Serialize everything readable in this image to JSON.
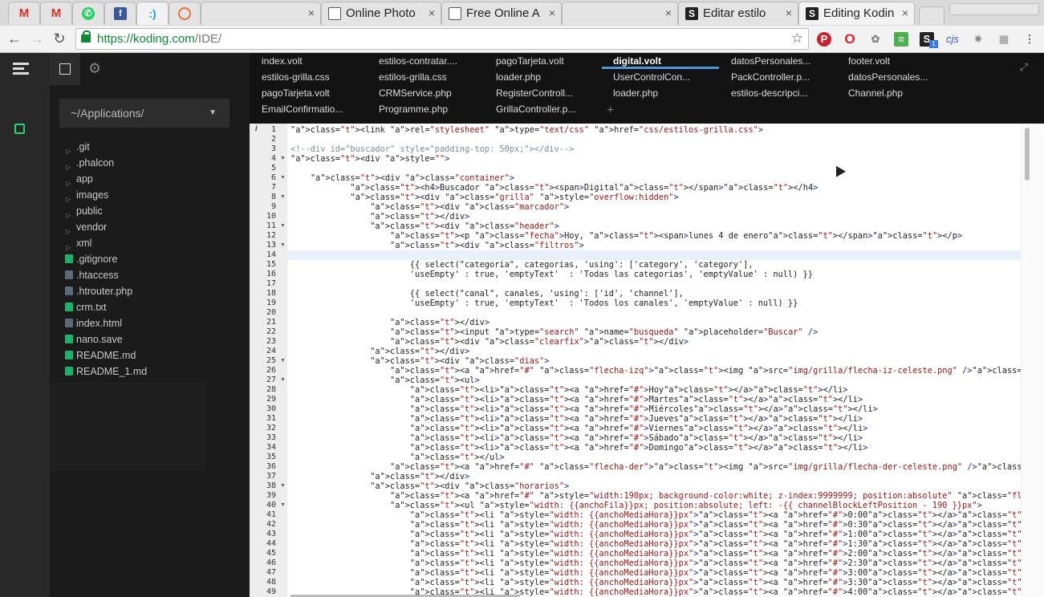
{
  "browser": {
    "tabs": [
      {
        "title": "",
        "icon": "gmail-icon",
        "pinned": true
      },
      {
        "title": "",
        "icon": "gmail-icon",
        "pinned": true
      },
      {
        "title": "",
        "icon": "whatsapp-icon",
        "pinned": true
      },
      {
        "title": "",
        "icon": "facebook-icon",
        "pinned": true
      },
      {
        "title": "",
        "icon": "koding-icon",
        "pinned": true,
        "active": true
      },
      {
        "title": "",
        "icon": "settings-icon",
        "pinned": true
      },
      {
        "title": "",
        "icon": "blank-icon",
        "pinned": false
      },
      {
        "title": "Online Photo",
        "icon": "page-icon"
      },
      {
        "title": "Free Online A",
        "icon": "page-icon"
      },
      {
        "title": "",
        "icon": "blank-icon"
      },
      {
        "title": "Editar estilo",
        "icon": "stylish-icon"
      },
      {
        "title": "Editing Kodin",
        "icon": "stylish-icon"
      }
    ],
    "url": {
      "host": "https://koding.com",
      "path": "/IDE/"
    },
    "extensions": [
      "pinterest-icon",
      "opera-icon",
      "extension-icon",
      "clipboard-icon",
      "stylish-icon",
      "cjs-icon",
      "gear-icon",
      "grid-icon"
    ],
    "ext_cjs_label": "cjs",
    "ext_badge": "1"
  },
  "ide": {
    "folder": "~/Applications/",
    "files": [
      {
        "name": ".git",
        "type": "folder"
      },
      {
        "name": ".phalcon",
        "type": "folder"
      },
      {
        "name": "app",
        "type": "folder"
      },
      {
        "name": "images",
        "type": "folder"
      },
      {
        "name": "public",
        "type": "folder"
      },
      {
        "name": "vendor",
        "type": "folder"
      },
      {
        "name": "xml",
        "type": "folder"
      },
      {
        "name": ".gitignore",
        "type": "file",
        "color": "#19b36b"
      },
      {
        "name": ".htaccess",
        "type": "file",
        "color": "#5a6a7a"
      },
      {
        "name": ".htrouter.php",
        "type": "file",
        "color": "#5a6a7a"
      },
      {
        "name": "crm.txt",
        "type": "file",
        "color": "#19b36b"
      },
      {
        "name": "index.html",
        "type": "file",
        "color": "#5a6a7a"
      },
      {
        "name": "nano.save",
        "type": "file",
        "color": "#19b36b"
      },
      {
        "name": "README.md",
        "type": "file",
        "color": "#19b36b"
      },
      {
        "name": "README_1.md",
        "type": "file",
        "color": "#19b36b"
      }
    ],
    "editor_tabs": [
      [
        "index.volt",
        "estilos-contratar....",
        "pagoTarjeta.volt",
        "digital.volt",
        "datosPersonales...",
        "footer.volt"
      ],
      [
        "estilos-grilla.css",
        "estilos-grilla.css",
        "loader.php",
        "UserControlCon...",
        "PackController.p...",
        "datosPersonales..."
      ],
      [
        "pagoTarjeta.volt",
        "CRMService.php",
        "RegisterControll...",
        "loader.php",
        "estilos-descripci...",
        "Channel.php"
      ],
      [
        "EmailConfirmatio...",
        "Programme.php",
        "GrillaController.p..."
      ]
    ],
    "active_tab": "digital.volt",
    "gutter_info": "i",
    "code_lines": [
      "<link rel=\"stylesheet\" type=\"text/css\" href=\"css/estilos-grilla.css\">",
      "",
      "<!--div id=\"buscador\" style=\"padding-top: 50px;\"></div-->",
      "<div style=\"\">",
      "",
      "    <div class=\"container\">",
      "            <h4>Buscador <span>Digital</span></h4>",
      "            <div class=\"grilla\" style=\"overflow:hidden\">",
      "                <div class=\"marcador\">",
      "                </div>",
      "                <div class=\"header\">",
      "                    <p class=\"fecha\">Hoy, <span>lunes 4 de enero</span></p>",
      "                    <div class=\"filtros\">",
      "",
      "                        {{ select(\"categoria\", categorias, 'using': ['category', 'category'],",
      "                        'useEmpty' : true, 'emptyText'  : 'Todas las categorias', 'emptyValue' : null) }}",
      "",
      "                        {{ select(\"canal\", canales, 'using': ['id', 'channel'],",
      "                        'useEmpty' : true, 'emptyText'  : 'Todos los canales', 'emptyValue' : null) }}",
      "",
      "                    </div>",
      "                    <input type=\"search\" name=\"busqueda\" placeholder=\"Buscar\" />",
      "                    <div class=\"clearfix\"></div>",
      "                </div>",
      "                <div class=\"dias\">",
      "                    <a href=\"#\" class=\"flecha-izq\"><img src=\"img/grilla/flecha-iz-celeste.png\" /></a>",
      "                    <ul>",
      "                        <li><a href=\"#\">Hoy</a></li>",
      "                        <li><a href=\"#\">Martes</a></li>",
      "                        <li><a href=\"#\">Miércoles</a></li>",
      "                        <li><a href=\"#\">Jueves</a></li>",
      "                        <li><a href=\"#\">Viernes</a></li>",
      "                        <li><a href=\"#\">Sábado</a></li>",
      "                        <li><a href=\"#\">Domingo</a></li>",
      "                        </ul>",
      "                    <a href=\"#\" class=\"flecha-der\"><img src=\"img/grilla/flecha-der-celeste.png\" /></a>",
      "                </div>",
      "                <div class=\"horarios\">",
      "                    <a href=\"#\" style=\"width:190px; background-color:white; z-index:9999999; position:absolute\" class=\"flecha-izq\"><img src=\"img/grilla/",
      "                    <ul style=\"width: {{anchoFila}}px; position:absolute; left: -{{ channelBlockLeftPosition - 190 }}px\">",
      "                        <li style=\"width: {{anchoMediaHora}}px\"><a href=\"#\">0:00</a></li>",
      "                        <li style=\"width: {{anchoMediaHora}}px\"><a href=\"#\">0:30</a></li>",
      "                        <li style=\"width: {{anchoMediaHora}}px\"><a href=\"#\">1:00</a></li>",
      "                        <li style=\"width: {{anchoMediaHora}}px\"><a href=\"#\">1:30</a></li>",
      "                        <li style=\"width: {{anchoMediaHora}}px\"><a href=\"#\">2:00</a></li>",
      "                        <li style=\"width: {{anchoMediaHora}}px\"><a href=\"#\">2:30</a></li>",
      "                        <li style=\"width: {{anchoMediaHora}}px\"><a href=\"#\">3:00</a></li>",
      "                        <li style=\"width: {{anchoMediaHora}}px\"><a href=\"#\">3:30</a></li>",
      "                        <li style=\"width: {{anchoMediaHora}}px\"><a href=\"#\">4:00</a></li>"
    ],
    "fold_lines": [
      4,
      6,
      8,
      11,
      13,
      25,
      27,
      38,
      40
    ],
    "highlight_line": 14
  }
}
